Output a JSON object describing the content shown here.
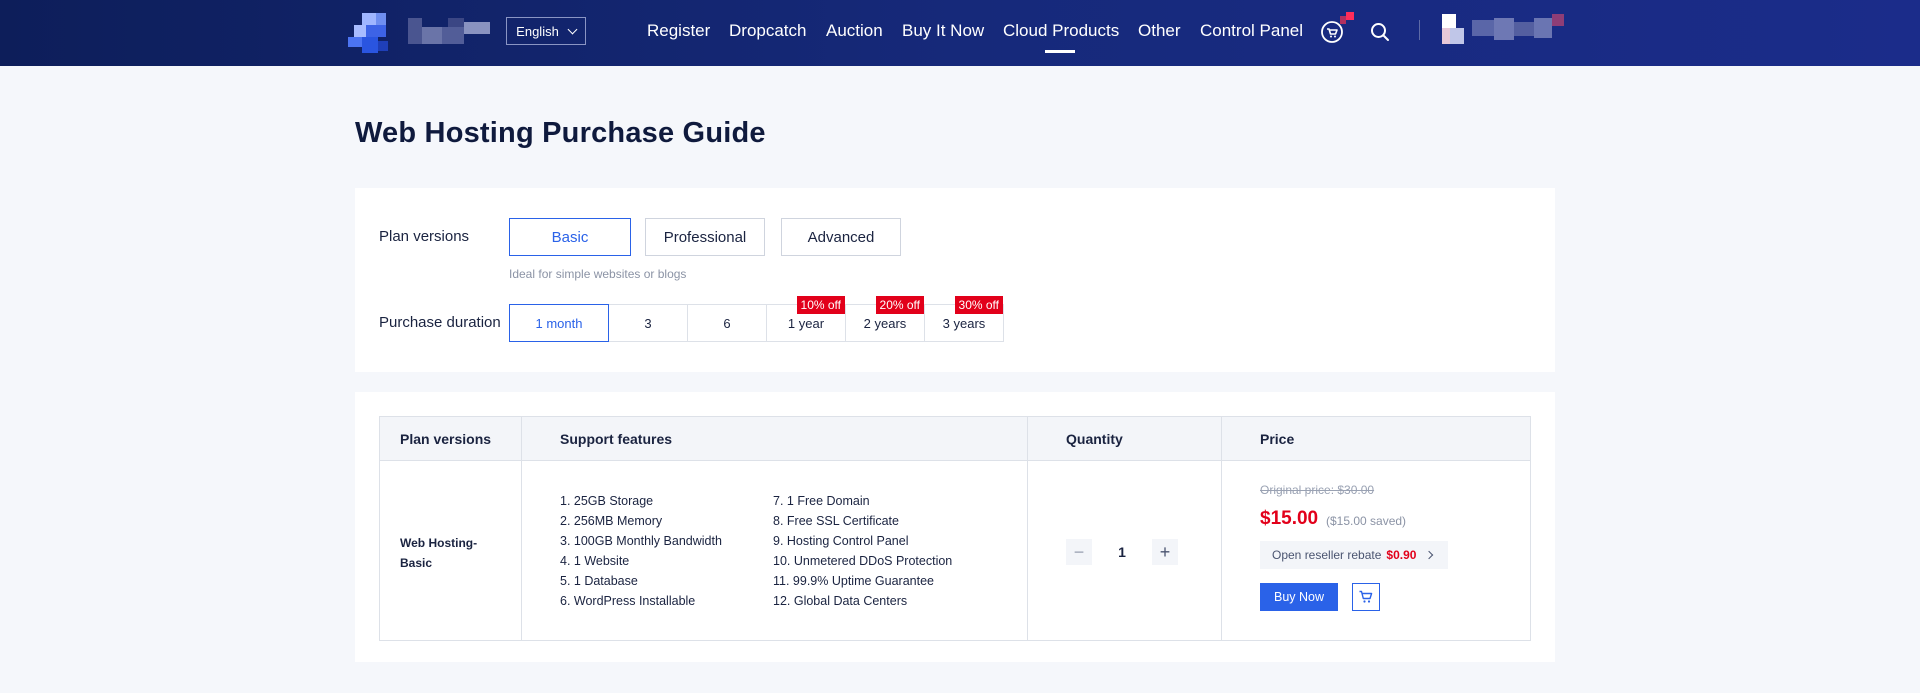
{
  "header": {
    "language": "English",
    "nav": [
      "Register",
      "Dropcatch",
      "Auction",
      "Buy It Now",
      "Cloud Products",
      "Other",
      "Control Panel"
    ],
    "active_nav": "Cloud Products",
    "icons": [
      "cart-icon",
      "search-icon",
      "chevron-down-icon"
    ]
  },
  "page": {
    "title": "Web Hosting Purchase Guide"
  },
  "selector": {
    "plan_label": "Plan versions",
    "plans": [
      "Basic",
      "Professional",
      "Advanced"
    ],
    "selected_plan": "Basic",
    "plan_desc": "Ideal for simple websites or blogs",
    "duration_label": "Purchase duration",
    "durations": [
      {
        "label": "1 month",
        "badge": ""
      },
      {
        "label": "3",
        "badge": ""
      },
      {
        "label": "6",
        "badge": ""
      },
      {
        "label": "1 year",
        "badge": "10% off"
      },
      {
        "label": "2 years",
        "badge": "20% off"
      },
      {
        "label": "3 years",
        "badge": "30% off"
      }
    ],
    "selected_duration": "1 month"
  },
  "table": {
    "headers": [
      "Plan versions",
      "Support features",
      "Quantity",
      "Price"
    ],
    "plan_name": "Web Hosting-Basic",
    "features_left": [
      "1. 25GB Storage",
      "2. 256MB Memory",
      "3. 100GB Monthly Bandwidth",
      "4. 1 Website",
      "5. 1 Database",
      "6. WordPress Installable"
    ],
    "features_right": [
      "7. 1 Free Domain",
      "8. Free SSL Certificate",
      "9. Hosting Control Panel",
      "10. Unmetered DDoS Protection",
      "11. 99.9% Uptime Guarantee",
      "12. Global Data Centers"
    ],
    "quantity": "1",
    "original_price": "Original price: $30.00",
    "price": "$15.00",
    "saved": "($15.00 saved)",
    "rebate_label": "Open reseller rebate",
    "rebate_value": "$0.90",
    "buy_label": "Buy Now"
  },
  "colors": {
    "accent": "#2a62e8",
    "sale": "#e2001a",
    "header": "#16297a"
  }
}
